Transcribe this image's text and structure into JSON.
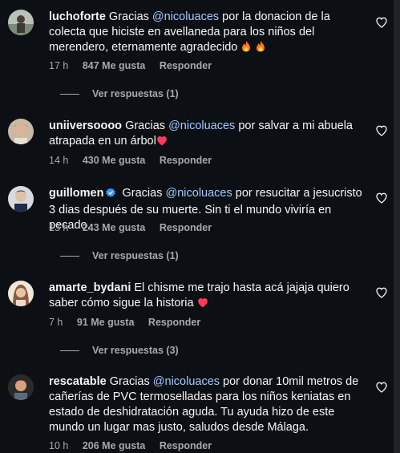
{
  "comments": [
    {
      "username": "luchoforte",
      "verified": false,
      "text_before": "Gracias ",
      "mention": "@nicoluaces",
      "text_after": " por la donacion de la colecta que hiciste en avellaneda para los niños del merendero, eternamente agradecido",
      "emojis": [
        "fire",
        "fire"
      ],
      "time": "17 h",
      "likes": "847 Me gusta",
      "reply": "Responder",
      "view_replies": "Ver respuestas (1)"
    },
    {
      "username": "uniiversoooo",
      "verified": false,
      "text_before": "Gracias ",
      "mention": "@nicoluaces",
      "text_after": " por salvar a mi abuela atrapada en un árbol",
      "emojis": [
        "heart"
      ],
      "time": "14 h",
      "likes": "430 Me gusta",
      "reply": "Responder"
    },
    {
      "username": "guillomen",
      "verified": true,
      "text_before": "Gracias ",
      "mention": "@nicoluaces",
      "text_after": " por resucitar a jesucristo 3 dias después de su muerte. Sin ti el mundo viviría en pecado.",
      "time": "13 h",
      "likes": "243 Me gusta",
      "reply": "Responder",
      "view_replies": "Ver respuestas (1)"
    },
    {
      "username": "amarte_bydani",
      "verified": false,
      "text_before": "El chisme me trajo hasta acá jajaja quiero saber cómo sigue la historia",
      "mention": "",
      "text_after": "",
      "emojis": [
        "heart"
      ],
      "time": "7 h",
      "likes": "91 Me gusta",
      "reply": "Responder",
      "view_replies": "Ver respuestas (3)"
    },
    {
      "username": "rescatable",
      "verified": false,
      "text_before": "Gracias ",
      "mention": "@nicoluaces",
      "text_after": " por donar 10mil metros de cañerías de PVC termoselladas para los niños keniatas en estado de deshidratación aguda. Tu ayuda hizo de este mundo un lugar mas justo, saludos desde Málaga.",
      "time": "10 h",
      "likes": "206 Me gusta",
      "reply": "Responder"
    }
  ],
  "colors": {
    "background": "#0c1014",
    "mention": "#a4c8ff",
    "meta": "#a8a8a8",
    "verified": "#3897f0",
    "heart": "#ff3040",
    "fire": "#ff7a1a"
  },
  "icons": {
    "like": "heart-outline-icon",
    "verified": "verified-badge-icon",
    "emoji_heart": "heart-emoji-icon",
    "emoji_fire": "fire-emoji-icon"
  }
}
